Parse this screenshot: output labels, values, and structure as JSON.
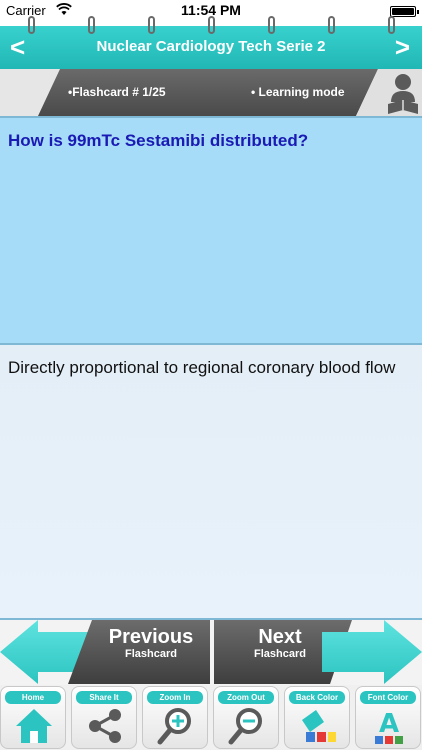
{
  "status_bar": {
    "carrier": "Carrier",
    "time": "11:54 PM"
  },
  "header": {
    "title": "Nuclear Cardiology Tech Serie 2",
    "back_icon": "chevron-left-icon",
    "forward_icon": "chevron-right-icon"
  },
  "info": {
    "card_counter": "•Flashcard #  1/25",
    "mode": "• Learning mode"
  },
  "card": {
    "question": "How is 99mTc Sestamibi distributed?",
    "answer": "Directly proportional to regional coronary blood flow"
  },
  "navigation": {
    "previous_title": "Previous",
    "previous_sub": "Flashcard",
    "next_title": "Next",
    "next_sub": "Flashcard"
  },
  "toolbar": {
    "items": [
      {
        "label": "Home",
        "icon": "home-icon"
      },
      {
        "label": "Share It",
        "icon": "share-icon"
      },
      {
        "label": "Zoom In",
        "icon": "zoom-in-icon"
      },
      {
        "label": "Zoom Out",
        "icon": "zoom-out-icon"
      },
      {
        "label": "Back Color",
        "icon": "back-color-icon"
      },
      {
        "label": "Font Color",
        "icon": "font-color-icon"
      }
    ]
  },
  "colors": {
    "accent": "#20b7b4",
    "question_bg": "#a6dcf7",
    "question_text": "#1a1ab5",
    "strip_dark": "#5a5a5a"
  }
}
